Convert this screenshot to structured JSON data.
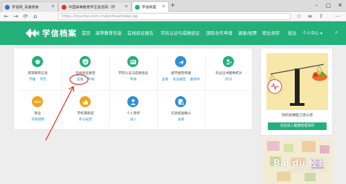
{
  "browser": {
    "tabs": [
      {
        "title": "学信网_百度搜索",
        "favicon_color": "#3b6fd4",
        "active": false
      },
      {
        "title": "中国高等教育学生信息网（学",
        "favicon_color": "#d93a2b",
        "active": false
      },
      {
        "title": "学信档案",
        "favicon_color": "#23b07a",
        "active": true
      }
    ],
    "url": "https://my.chsi.com.cn/archive/index.jsp",
    "icons": [
      "back-icon",
      "forward-icon",
      "refresh-icon",
      "home-icon",
      "star-icon",
      "menu-icon"
    ]
  },
  "header": {
    "site_name": "学信档案",
    "brand_color": "#23b07a",
    "menu": [
      "首页",
      "高等教育信息",
      "在线验证报告",
      "学历认证与成绩验证",
      "国际合作申请",
      "调查/投票",
      "职业测评",
      "就业"
    ],
    "user_menu": "个人中心 ▾"
  },
  "services": [
    {
      "title": "高等教育信息",
      "links": [
        "学籍",
        "学历"
      ],
      "icon": "graduation-cap-icon",
      "color": "#23b07a"
    },
    {
      "title": "在线验证报告",
      "links": [
        "查看",
        "申请"
      ],
      "icon": "shield-check-icon",
      "color": "#23b07a"
    },
    {
      "title": "学历认证与成绩验证",
      "links": [
        "申请"
      ],
      "icon": "id-card-icon",
      "color": "#23b07a"
    },
    {
      "title": "留学报告传输",
      "links": [
        "查看",
        "发送报告",
        "翻译件"
      ],
      "icon": "plane-icon",
      "color": "#2f8fd6"
    },
    {
      "title": "毕业证书图像校对",
      "links": [
        "校对"
      ],
      "icon": "user-check-icon",
      "color": "#23b07a"
    },
    {
      "title": "就业",
      "links": [
        "求职招聘"
      ],
      "icon": "offer-icon",
      "color": "#f0a31b"
    },
    {
      "title": "学校满意度",
      "links": [
        "参与投票"
      ],
      "icon": "thumbs-up-icon",
      "color": "#f0a31b"
    },
    {
      "title": "个人测评",
      "links": [
        "进入"
      ],
      "icon": "person-icon",
      "color": "#2f8fd6"
    },
    {
      "title": "信息核查确认",
      "links": [
        "查看"
      ],
      "icon": "search-doc-icon",
      "color": "#2f8fd6"
    }
  ],
  "promo": {
    "caption": "你的自律能力怎么样",
    "button": "点击进入健康管理测评"
  },
  "watermark": {
    "text": "Bai du 经验",
    "sub": "jingyan.baidu.com"
  }
}
